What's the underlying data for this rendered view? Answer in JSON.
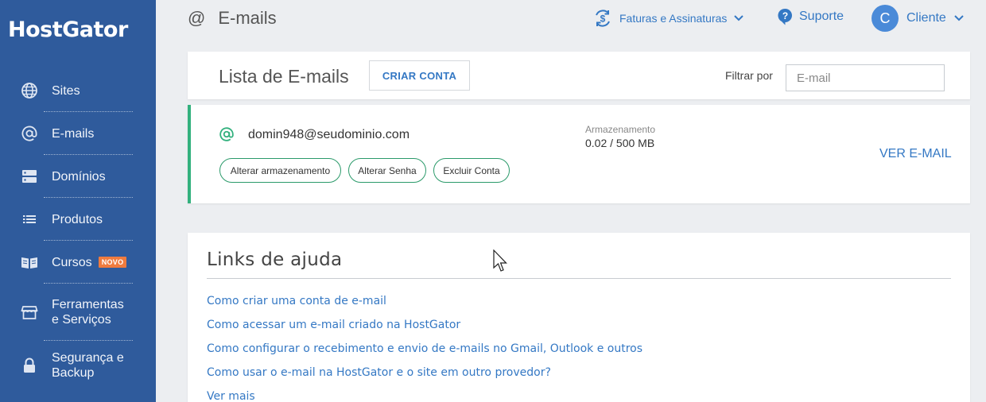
{
  "sidebar": {
    "logo": "HostGator",
    "items": [
      {
        "label": "Sites",
        "icon": "globe-icon"
      },
      {
        "label": "E-mails",
        "icon": "at-icon"
      },
      {
        "label": "Domínios",
        "icon": "server-icon"
      },
      {
        "label": "Produtos",
        "icon": "list-icon"
      },
      {
        "label": "Cursos",
        "icon": "book-icon",
        "badge": "NOVO"
      },
      {
        "label": "Ferramentas",
        "label2": "e Serviços",
        "icon": "store-icon"
      },
      {
        "label": "Segurança e",
        "label2": "Backup",
        "icon": "lock-icon"
      }
    ]
  },
  "header": {
    "title": "E-mails",
    "billing": "Faturas e Assinaturas",
    "support": "Suporte",
    "user_initial": "C",
    "user_name": "Cliente"
  },
  "list": {
    "title": "Lista de E-mails",
    "create_button": "CRIAR CONTA",
    "filter_label": "Filtrar por",
    "filter_placeholder": "E-mail"
  },
  "email_account": {
    "address": "domin948@seudominio.com",
    "storage_label": "Armazenamento",
    "storage_value": "0.02 / 500 MB",
    "view_link": "VER E-MAIL",
    "actions": [
      "Alterar armazenamento",
      "Alterar Senha",
      "Excluir Conta"
    ]
  },
  "help": {
    "title": "Links de ajuda",
    "links": [
      "Como criar uma conta de e-mail",
      "Como acessar um e-mail criado na HostGator",
      "Como configurar o recebimento e envio de e-mails no Gmail, Outlook e outros",
      "Como usar o e-mail na HostGator e o site em outro provedor?",
      "Ver mais"
    ]
  },
  "colors": {
    "sidebar": "#2f5b9c",
    "link": "#3478c4",
    "accent_green": "#33b17e",
    "badge": "#ef7b3e"
  }
}
